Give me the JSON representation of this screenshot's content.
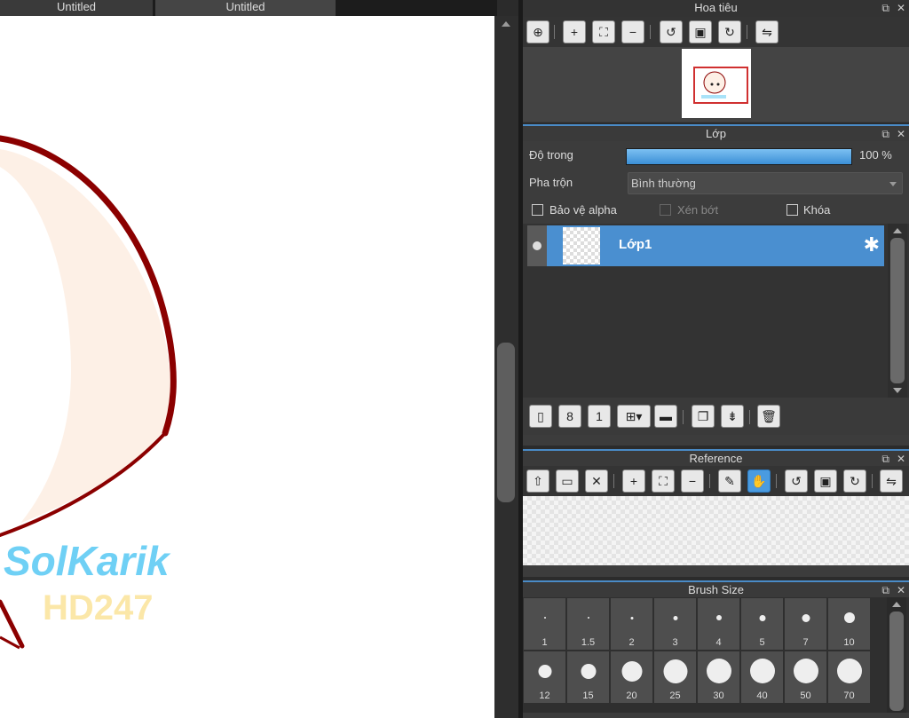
{
  "tabs": [
    {
      "label": "Untitled"
    },
    {
      "label": "Untitled"
    }
  ],
  "navigator": {
    "title": "Hoa tiêu"
  },
  "layer_panel": {
    "title": "Lớp",
    "opacity_label": "Độ trong",
    "opacity_value": "100 %",
    "opacity_fraction": 1.0,
    "blend_label": "Pha trộn",
    "blend_value": "Bình thường",
    "protect_alpha": "Bảo vệ alpha",
    "clipping": "Xén bớt",
    "lock": "Khóa",
    "layers": [
      {
        "name": "Lớp1",
        "selected": true
      }
    ]
  },
  "reference": {
    "title": "Reference"
  },
  "brush_size": {
    "title": "Brush Size",
    "sizes": [
      "1",
      "1.5",
      "2",
      "3",
      "4",
      "5",
      "7",
      "10",
      "12",
      "15",
      "20",
      "25",
      "30",
      "40",
      "50",
      "70"
    ]
  },
  "canvas_art": {
    "signature_text": "SolKarik",
    "watermark_text": "HD247"
  },
  "colors": {
    "accent": "#4a8fd0",
    "stroke": "#8b0000",
    "skin": "#fdf0e6"
  }
}
